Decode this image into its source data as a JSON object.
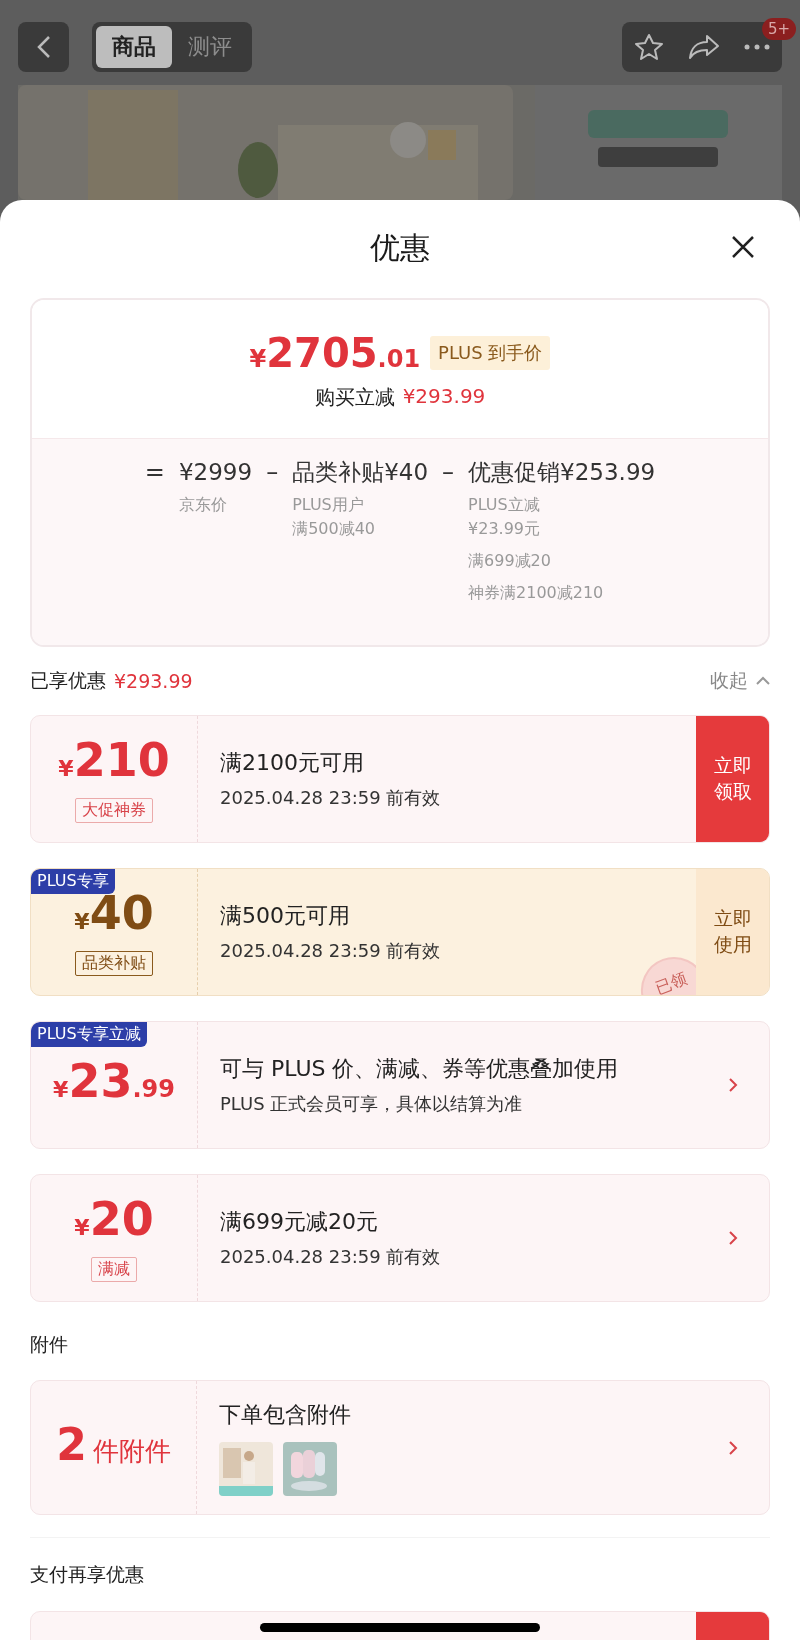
{
  "nav": {
    "tabs": [
      {
        "label": "商品",
        "selected": true
      },
      {
        "label": "测评",
        "selected": false
      }
    ],
    "badge": "5+"
  },
  "sheet": {
    "title": "优惠"
  },
  "price_card": {
    "price": {
      "currency": "¥",
      "integer": "2705",
      "decimal": ".01"
    },
    "tag": "PLUS 到手价",
    "saving_label": "购买立减",
    "saving_value": "¥293.99",
    "breakdown": [
      {
        "operator": "=",
        "text": "¥2999",
        "notes": [
          [
            "京东价"
          ]
        ]
      },
      {
        "operator": "–",
        "text": "品类补贴¥40",
        "notes": [
          [
            "PLUS用户",
            "满500减40"
          ]
        ]
      },
      {
        "operator": "–",
        "text": "优惠促销¥253.99",
        "notes": [
          [
            "PLUS立减",
            "¥23.99元"
          ],
          [
            "满699减20"
          ],
          [
            "神券满2100减210"
          ]
        ]
      }
    ]
  },
  "discount_section": {
    "label": "已享优惠",
    "total": "¥293.99",
    "toggle": "收起",
    "expanded": true
  },
  "coupons": [
    {
      "kind": "red",
      "currency": "¥",
      "amount": "210",
      "tag": "大促神券",
      "title": "满2100元可用",
      "subtitle": "2025.04.28 23:59 前有效",
      "action": {
        "kind": "filled",
        "label": "立即领取"
      }
    },
    {
      "kind": "gold",
      "badge": "PLUS专享",
      "currency": "¥",
      "amount": "40",
      "tag": "品类补贴",
      "title": "满500元可用",
      "subtitle": "2025.04.28 23:59 前有效",
      "action": {
        "kind": "tinted",
        "label": "立即使用"
      },
      "stamp": "已领"
    },
    {
      "kind": "red",
      "badge": "PLUS专享立减",
      "currency": "¥",
      "amount": "23",
      "decimal": ".99",
      "title": "可与 PLUS 价、满减、券等优惠叠加使用",
      "subtitle": "PLUS 正式会员可享，具体以结算为准",
      "action": {
        "kind": "chevron"
      }
    },
    {
      "kind": "red",
      "currency": "¥",
      "amount": "20",
      "tag": "满减",
      "title": "满699元减20元",
      "subtitle": "2025.04.28 23:59 前有效",
      "action": {
        "kind": "chevron"
      }
    }
  ],
  "attachments": {
    "heading": "附件",
    "count": "2",
    "unit": "件附件",
    "title": "下单包含附件"
  },
  "payment": {
    "heading": "支付再享优惠"
  }
}
